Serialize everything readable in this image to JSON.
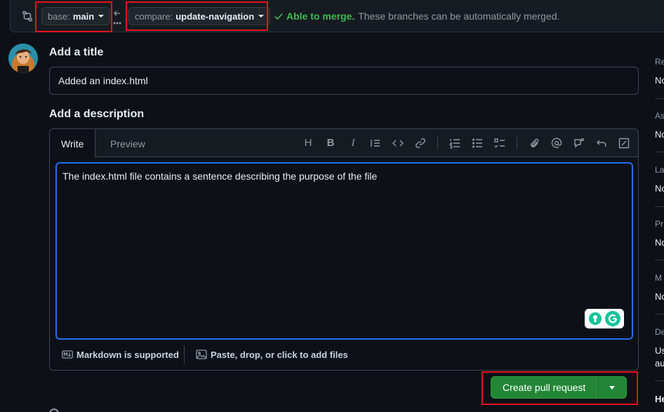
{
  "compare": {
    "base_label": "base:",
    "base_value": "main",
    "compare_label": "compare:",
    "compare_value": "update-navigation",
    "merge_ok": "Able to merge.",
    "merge_rest": "These branches can be automatically merged."
  },
  "form": {
    "title_heading": "Add a title",
    "title_value": "Added an index.html",
    "description_heading": "Add a description",
    "tab_write": "Write",
    "tab_preview": "Preview",
    "description_value": "The index.html file contains a sentence describing the purpose of the file",
    "markdown_note": "Markdown is supported",
    "attach_note": "Paste, drop, or click to add files",
    "submit_label": "Create pull request"
  },
  "sidebar": {
    "items": [
      {
        "head": "Re",
        "value": "No"
      },
      {
        "head": "As",
        "value": "No"
      },
      {
        "head": "La",
        "value": "No"
      },
      {
        "head": "Pr",
        "value": "No"
      },
      {
        "head": "M",
        "value": "No"
      },
      {
        "head": "De",
        "value": "Us",
        "value2": "au"
      },
      {
        "head": "He"
      }
    ]
  },
  "colors": {
    "accent": "#1f6feb",
    "success": "#3fb950",
    "button": "#238636",
    "highlight": "#e3141b"
  }
}
